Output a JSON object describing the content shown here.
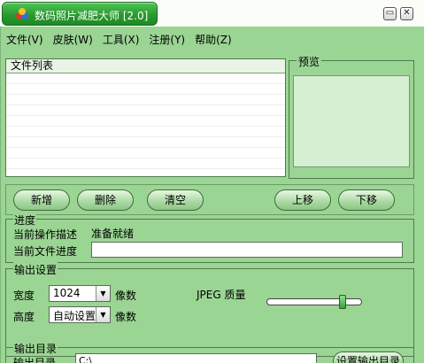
{
  "window": {
    "title": "数码照片减肥大师 [2.0]",
    "minimize_glyph": "▭",
    "close_glyph": "✕"
  },
  "menu": [
    "文件(V)",
    "皮肤(W)",
    "工具(X)",
    "注册(Y)",
    "帮助(Z)"
  ],
  "file_list": {
    "header": "文件列表"
  },
  "preview": {
    "label": "预览"
  },
  "buttons": {
    "add": "新增",
    "delete": "删除",
    "clear": "清空",
    "move_up": "上移",
    "move_down": "下移"
  },
  "progress": {
    "legend": "进度",
    "current_op_label": "当前操作描述",
    "current_op_value": "准备就绪",
    "file_progress_label": "当前文件进度"
  },
  "output_settings": {
    "legend": "输出设置",
    "width_label": "宽度",
    "width_value": "1024",
    "width_unit": "像数",
    "height_label": "高度",
    "height_value": "自动设置",
    "height_unit": "像数",
    "jpeg_label": "JPEG 质量",
    "jpeg_quality_fraction": 0.82
  },
  "output_dir": {
    "legend": "输出目录",
    "label": "输出目录",
    "path": "C:\\",
    "set_button": "设置输出目录"
  },
  "icons": {
    "app": "app-logo-icon",
    "combo_arrow": "▼"
  },
  "colors": {
    "title_green": "#2a9a30",
    "window_green": "#9bd594",
    "button_green": "#a8d8a0"
  }
}
